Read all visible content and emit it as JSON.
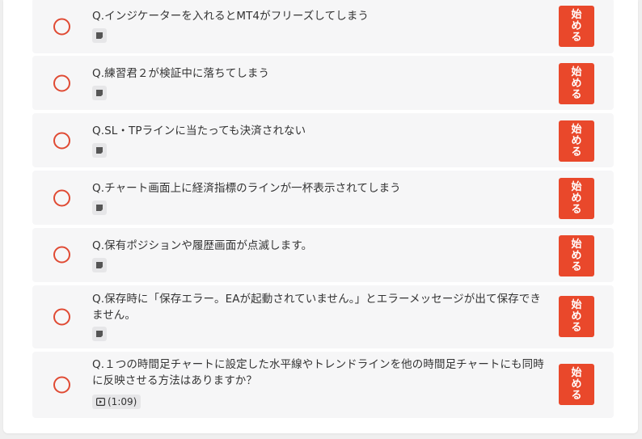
{
  "lessons": [
    {
      "title": "Q.インジケーターを入れるとMT4がフリーズしてしまう",
      "badge_icon": "text-doc-icon",
      "button_label": "始める"
    },
    {
      "title": "Q.練習君２が検証中に落ちてしまう",
      "badge_icon": "text-doc-icon",
      "button_label": "始める"
    },
    {
      "title": "Q.SL・TPラインに当たっても決済されない",
      "badge_icon": "text-doc-icon",
      "button_label": "始める"
    },
    {
      "title": "Q.チャート画面上に経済指標のラインが一杯表示されてしまう",
      "badge_icon": "text-doc-icon",
      "button_label": "始める"
    },
    {
      "title": "Q.保有ポジションや履歴画面が点滅します。",
      "badge_icon": "text-doc-icon",
      "button_label": "始める"
    },
    {
      "title": "Q.保存時に「保存エラー。EAが起動されていません。」とエラーメッセージが出て保存できません。",
      "badge_icon": "text-doc-icon",
      "button_label": "始める"
    },
    {
      "title": "Q.１つの時間足チャートに設定した水平線やトレンドラインを他の時間足チャートにも同時に反映させる方法はありますか？",
      "badge_icon": "video-icon",
      "duration": "(1:09)",
      "button_label": "始める"
    }
  ],
  "colors": {
    "accent": "#e9482b",
    "status_ring": "#e04a33",
    "row_bg": "#f6f6f7",
    "badge_bg": "#e6e6e8"
  }
}
